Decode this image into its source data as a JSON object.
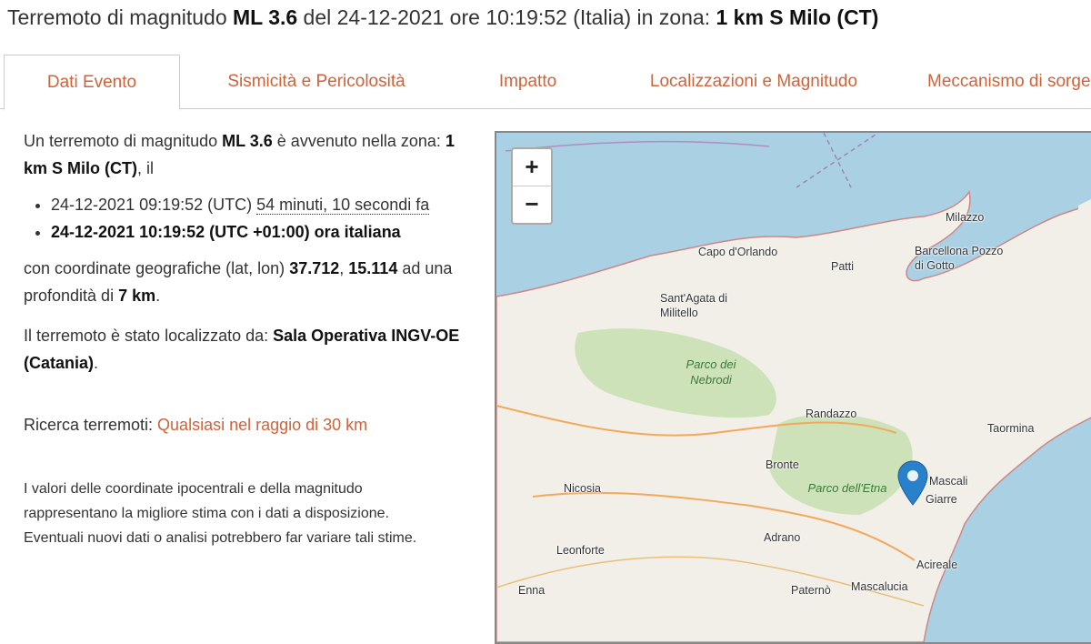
{
  "header": {
    "title_prefix": "Terremoto di magnitudo ",
    "magnitude": "ML 3.6",
    "title_mid": " del 24-12-2021 ore 10:19:52 (Italia) in zona: ",
    "zone": "1 km S Milo (CT)"
  },
  "tabs": [
    {
      "label": "Dati Evento"
    },
    {
      "label": "Sismicità e Pericolosità"
    },
    {
      "label": "Impatto"
    },
    {
      "label": "Localizzazioni e Magnitudo"
    },
    {
      "label": "Meccanismo di sorgente"
    }
  ],
  "summary": {
    "intro_a": "Un terremoto di magnitudo ",
    "magnitude": "ML 3.6",
    "intro_b": " è avvenuto nella zona: ",
    "zone": "1 km S Milo (CT)",
    "intro_c": ", il",
    "utc_time": "24-12-2021 09:19:52 (UTC) ",
    "elapsed": "54 minuti, 10 secondi fa",
    "local_time": "24-12-2021 10:19:52 (UTC +01:00) ora italiana",
    "coords_a": "con coordinate geografiche (lat, lon) ",
    "lat": "37.712",
    "comma": ", ",
    "lon": "15.114",
    "coords_b": " ad una profondità di ",
    "depth": "7 km",
    "period": ".",
    "located_a": "Il terremoto è stato localizzato da: ",
    "located_by": "Sala Operativa INGV-OE (Catania)",
    "search_label": "Ricerca terremoti: ",
    "search_link": "Qualsiasi nel raggio di 30 km",
    "note": "I valori delle coordinate ipocentrali e della magnitudo rappresentano la migliore stima con i dati a disposizione. Eventuali nuovi dati o analisi potrebbero far variare tali stime."
  },
  "map": {
    "zoom_in": "+",
    "zoom_out": "−",
    "places": [
      "Milazzo",
      "Capo d'Orlando",
      "Patti",
      "Barcellona Pozzo di Gotto",
      "Sant'Agata di Militello",
      "Randazzo",
      "Taormina",
      "Bronte",
      "Nicosia",
      "Mascali",
      "Giarre",
      "Adrano",
      "Leonforte",
      "Acireale",
      "Enna",
      "Paternò",
      "Mascalucia"
    ],
    "parks": [
      "Parco dei Nebrodi",
      "Parco dell'Etna"
    ],
    "colors": {
      "sea": "#a9d0e3",
      "land": "#f2efe9",
      "park": "#c8dfb0",
      "marker": "#2a81cb",
      "road": "#f2a95c"
    }
  }
}
